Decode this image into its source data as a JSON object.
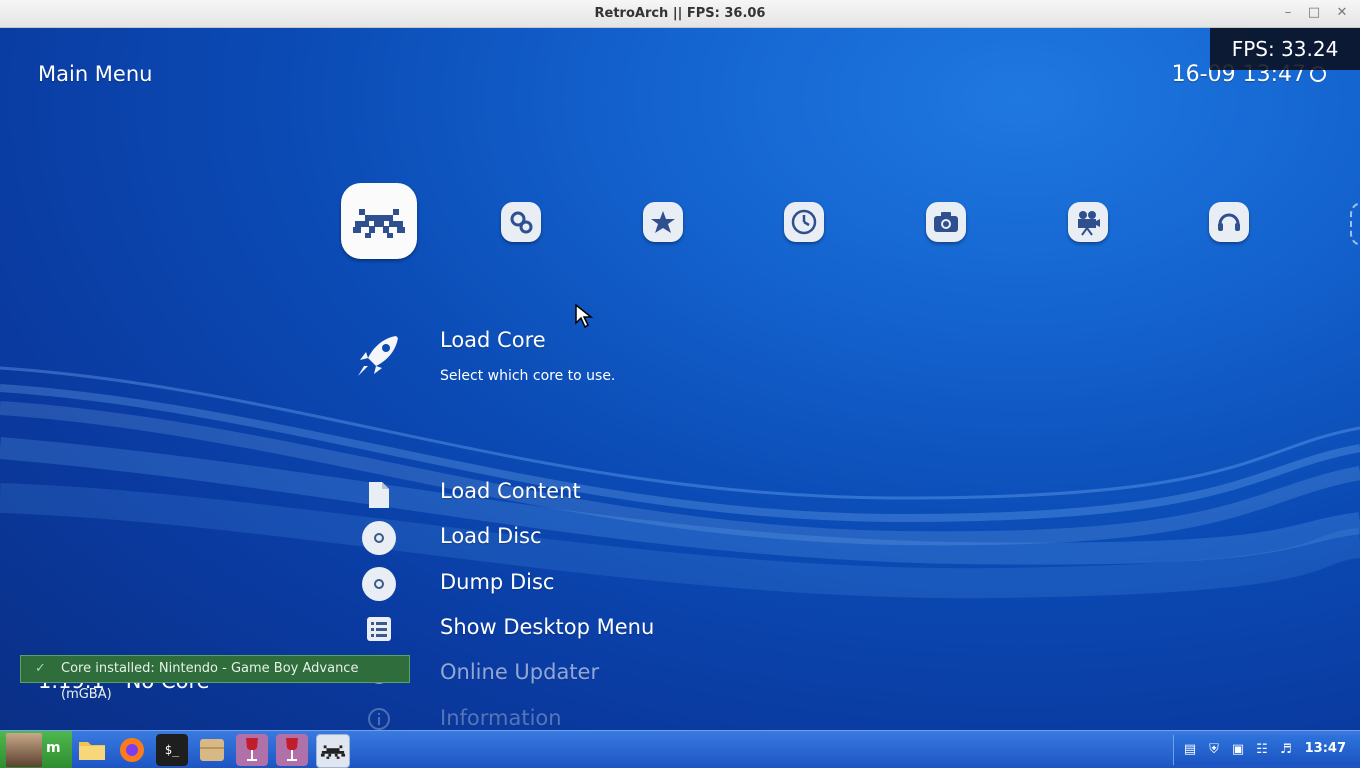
{
  "window": {
    "title": "RetroArch || FPS:  36.06",
    "minimize_icon": "minimize-icon",
    "maximize_icon": "maximize-icon",
    "close_icon": "close-icon"
  },
  "header": {
    "menu_title": "Main Menu",
    "clock": "16-09 13:47",
    "fps_overlay": "FPS:  33.24"
  },
  "tabs": [
    {
      "name": "main-menu",
      "icon": "retroarch-invader-icon",
      "active": true
    },
    {
      "name": "settings",
      "icon": "settings-icon"
    },
    {
      "name": "favorites",
      "icon": "star-icon"
    },
    {
      "name": "history",
      "icon": "clock-icon"
    },
    {
      "name": "images",
      "icon": "camera-icon"
    },
    {
      "name": "videos",
      "icon": "video-camera-icon"
    },
    {
      "name": "netplay",
      "icon": "headset-icon"
    }
  ],
  "menu": {
    "selected": {
      "label": "Load Core",
      "sublabel": "Select which core to use.",
      "icon": "rocket-icon"
    },
    "items": [
      {
        "label": "Load Content",
        "icon": "file-icon"
      },
      {
        "label": "Load Disc",
        "icon": "disc-icon"
      },
      {
        "label": "Dump Disc",
        "icon": "disc-icon"
      },
      {
        "label": "Show Desktop Menu",
        "icon": "list-icon"
      },
      {
        "label": "Online Updater",
        "icon": "globe-icon"
      },
      {
        "label": "Information",
        "icon": "info-icon"
      }
    ]
  },
  "footer": {
    "version": "1.19.1 - No Core",
    "notification": "Core installed: Nintendo - Game Boy Advance (mGBA)"
  },
  "taskbar": {
    "start_label": "m",
    "apps": [
      {
        "name": "file-manager",
        "icon": "folder-icon"
      },
      {
        "name": "firefox",
        "icon": "firefox-icon"
      },
      {
        "name": "terminal",
        "icon": "terminal-icon",
        "text": "$_"
      },
      {
        "name": "archive",
        "icon": "archive-icon"
      },
      {
        "name": "wine-app-1",
        "icon": "wine-glass-icon"
      },
      {
        "name": "wine-app-2",
        "icon": "wine-glass-icon"
      },
      {
        "name": "retroarch",
        "icon": "retroarch-invader-icon"
      }
    ],
    "tray_time": "13:47"
  },
  "colors": {
    "background": "#0a3fa8",
    "taskbar": "#2a6cd8",
    "notification_bg": "#2f6d3c"
  }
}
